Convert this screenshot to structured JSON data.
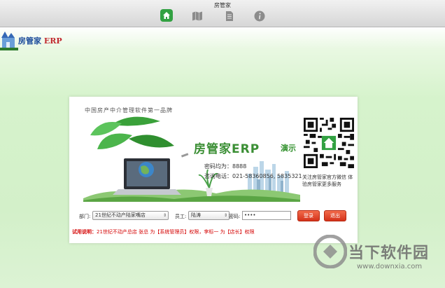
{
  "window": {
    "title": "房管家"
  },
  "toolbar": {
    "items": [
      {
        "icon": "home-icon"
      },
      {
        "icon": "map-icon"
      },
      {
        "icon": "document-icon"
      },
      {
        "icon": "info-icon"
      }
    ]
  },
  "brand": {
    "name": "房管家",
    "erp": "ERP"
  },
  "banner": {
    "slogan": "中国房产中介管理软件第一品牌",
    "app_name": "房管家ERP",
    "demo_tag": "演示",
    "password_hint": "密码均为：8888",
    "phone": "咨询电话：021-58360856, 5835321",
    "qr_caption": "关注房管家官方微信 体验房管家更多服务"
  },
  "form": {
    "department_label": "部门:",
    "department_value": "21世纪不动产陆家嘴店",
    "employee_label": "员工:",
    "employee_value": "陆涛",
    "password_label": "密码:",
    "password_value": "••••",
    "login_label": "登录",
    "exit_label": "退出"
  },
  "trial": {
    "label": "试用说明：",
    "text": "21世纪不动产总店 张总 为【系统管理员】权限，李标一 为【店长】权限"
  },
  "watermark": {
    "title": "当下软件园",
    "url": "www.downxia.com"
  },
  "colors": {
    "accent": "#32a142",
    "button": "#e04a2c",
    "warning": "#d40000"
  }
}
